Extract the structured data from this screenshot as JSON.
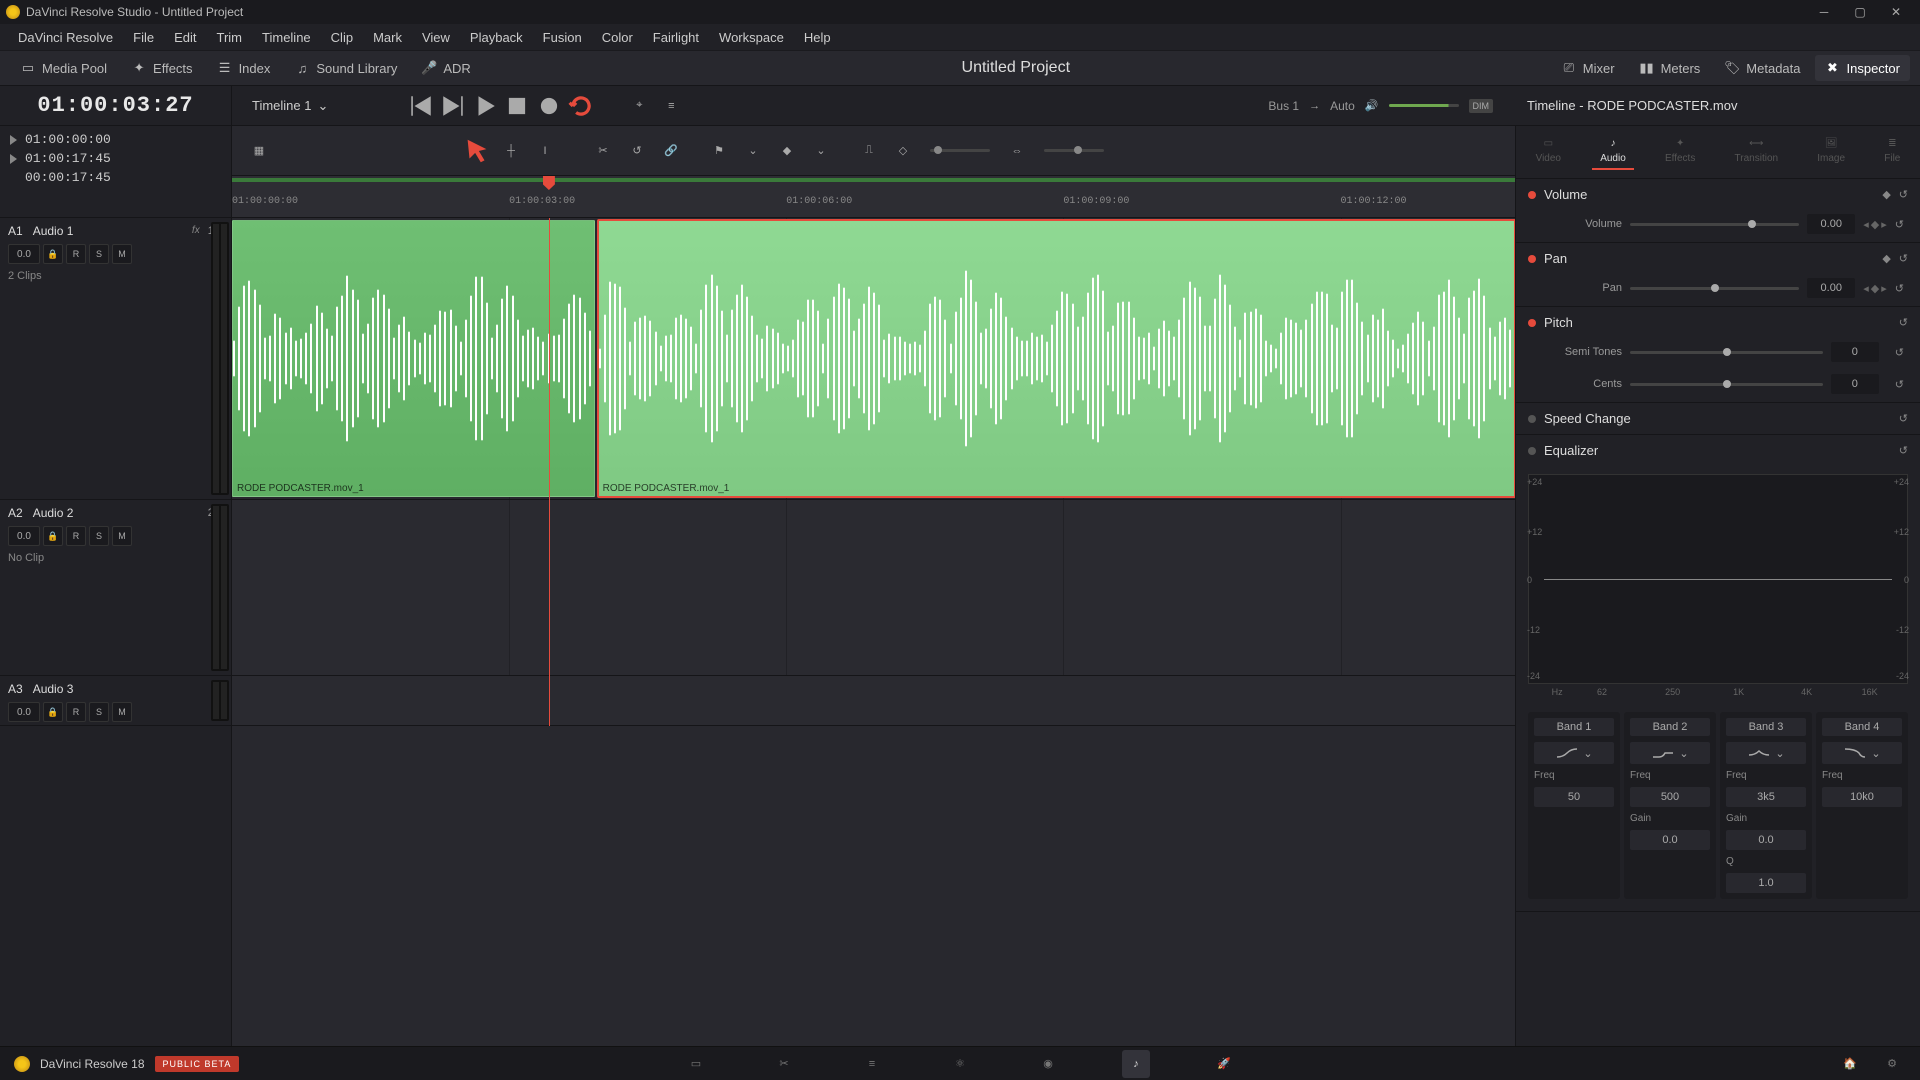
{
  "window": {
    "title": "DaVinci Resolve Studio - Untitled Project"
  },
  "menu": [
    "DaVinci Resolve",
    "File",
    "Edit",
    "Trim",
    "Timeline",
    "Clip",
    "Mark",
    "View",
    "Playback",
    "Fusion",
    "Color",
    "Fairlight",
    "Workspace",
    "Help"
  ],
  "toolrow": {
    "media_pool": "Media Pool",
    "effects": "Effects",
    "index": "Index",
    "sound_library": "Sound Library",
    "adr": "ADR",
    "mixer": "Mixer",
    "meters": "Meters",
    "metadata": "Metadata",
    "inspector": "Inspector"
  },
  "project_title": "Untitled Project",
  "timecode": "01:00:03:27",
  "timeline_name": "Timeline 1",
  "bus": {
    "label": "Bus 1",
    "mode": "Auto",
    "dim": "DIM"
  },
  "tc_rows": [
    "01:00:00:00",
    "01:00:17:45",
    "00:00:17:45"
  ],
  "ruler_ticks": [
    {
      "t": "01:00:00:00",
      "pct": 0
    },
    {
      "t": "01:00:03:00",
      "pct": 21.6
    },
    {
      "t": "01:00:06:00",
      "pct": 43.2
    },
    {
      "t": "01:00:09:00",
      "pct": 64.8
    },
    {
      "t": "01:00:12:00",
      "pct": 86.4
    }
  ],
  "playhead_pct": 24.7,
  "tracks": [
    {
      "id": "A1",
      "name": "Audio 1",
      "fx": "fx",
      "ratio": "1.0",
      "val": "0.0",
      "clips_label": "2 Clips"
    },
    {
      "id": "A2",
      "name": "Audio 2",
      "ratio": "2.0",
      "val": "0.0",
      "clips_label": "No Clip"
    },
    {
      "id": "A3",
      "name": "Audio 3",
      "val": "0.0"
    }
  ],
  "clips": [
    {
      "label": "RODE PODCASTER.mov_1",
      "left": 0,
      "width": 28.5
    },
    {
      "label": "RODE PODCASTER.mov_1",
      "left": 28.5,
      "width": 71.5
    }
  ],
  "inspector_title": "Timeline - RODE PODCASTER.mov",
  "inspector_tabs": [
    "Video",
    "Audio",
    "Effects",
    "Transition",
    "Image",
    "File"
  ],
  "inspector": {
    "volume": {
      "title": "Volume",
      "label": "Volume",
      "value": "0.00"
    },
    "pan": {
      "title": "Pan",
      "label": "Pan",
      "value": "0.00"
    },
    "pitch": {
      "title": "Pitch",
      "semi_label": "Semi Tones",
      "semi_val": "0",
      "cents_label": "Cents",
      "cents_val": "0"
    },
    "speed": {
      "title": "Speed Change"
    },
    "eq": {
      "title": "Equalizer"
    }
  },
  "eq_axis_y": [
    "+24",
    "+12",
    "0",
    "-12",
    "-24"
  ],
  "eq_axis_x": [
    "Hz",
    "62",
    "250",
    "1K",
    "4K",
    "16K"
  ],
  "bands": [
    {
      "name": "Band 1",
      "freq_label": "Freq",
      "freq": "50"
    },
    {
      "name": "Band 2",
      "freq_label": "Freq",
      "freq": "500",
      "gain_label": "Gain",
      "gain": "0.0"
    },
    {
      "name": "Band 3",
      "freq_label": "Freq",
      "freq": "3k5",
      "gain_label": "Gain",
      "gain": "0.0",
      "q_label": "Q",
      "q": "1.0"
    },
    {
      "name": "Band 4",
      "freq_label": "Freq",
      "freq": "10k0"
    }
  ],
  "bottom": {
    "app": "DaVinci Resolve 18",
    "beta": "PUBLIC BETA"
  }
}
